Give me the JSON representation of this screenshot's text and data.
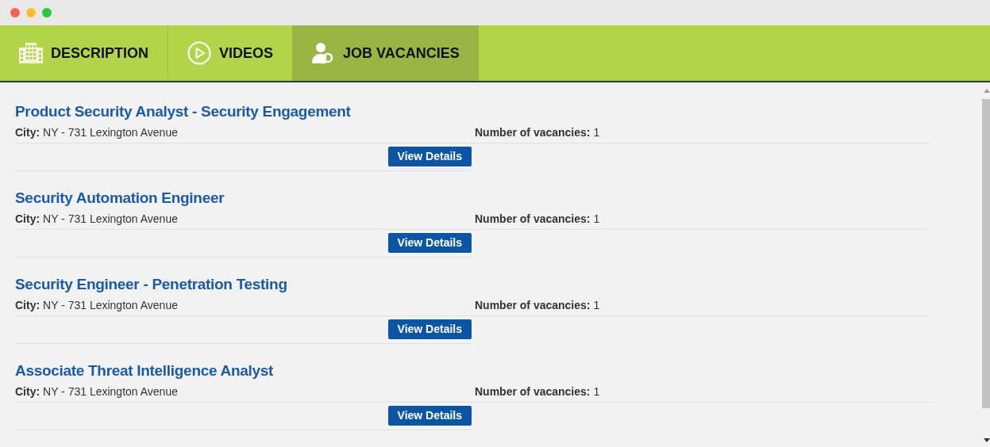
{
  "tabs": [
    {
      "label": "DESCRIPTION",
      "kind": "building",
      "selected": false
    },
    {
      "label": "VIDEOS",
      "kind": "play",
      "selected": false
    },
    {
      "label": "JOB VACANCIES",
      "kind": "person",
      "selected": true
    }
  ],
  "jobs": [
    {
      "title": "Product Security Analyst - Security Engagement",
      "city_label": "City:",
      "city": "NY - 731 Lexington Avenue",
      "vacancies_label": "Number of vacancies:",
      "vacancies": "1",
      "button": "View Details"
    },
    {
      "title": "Security Automation Engineer",
      "city_label": "City:",
      "city": "NY - 731 Lexington Avenue",
      "vacancies_label": "Number of vacancies:",
      "vacancies": "1",
      "button": "View Details"
    },
    {
      "title": "Security Engineer - Penetration Testing",
      "city_label": "City:",
      "city": "NY - 731 Lexington Avenue",
      "vacancies_label": "Number of vacancies:",
      "vacancies": "1",
      "button": "View Details"
    },
    {
      "title": "Associate Threat Intelligence Analyst",
      "city_label": "City:",
      "city": "NY - 731 Lexington Avenue",
      "vacancies_label": "Number of vacancies:",
      "vacancies": "1",
      "button": "View Details"
    }
  ]
}
